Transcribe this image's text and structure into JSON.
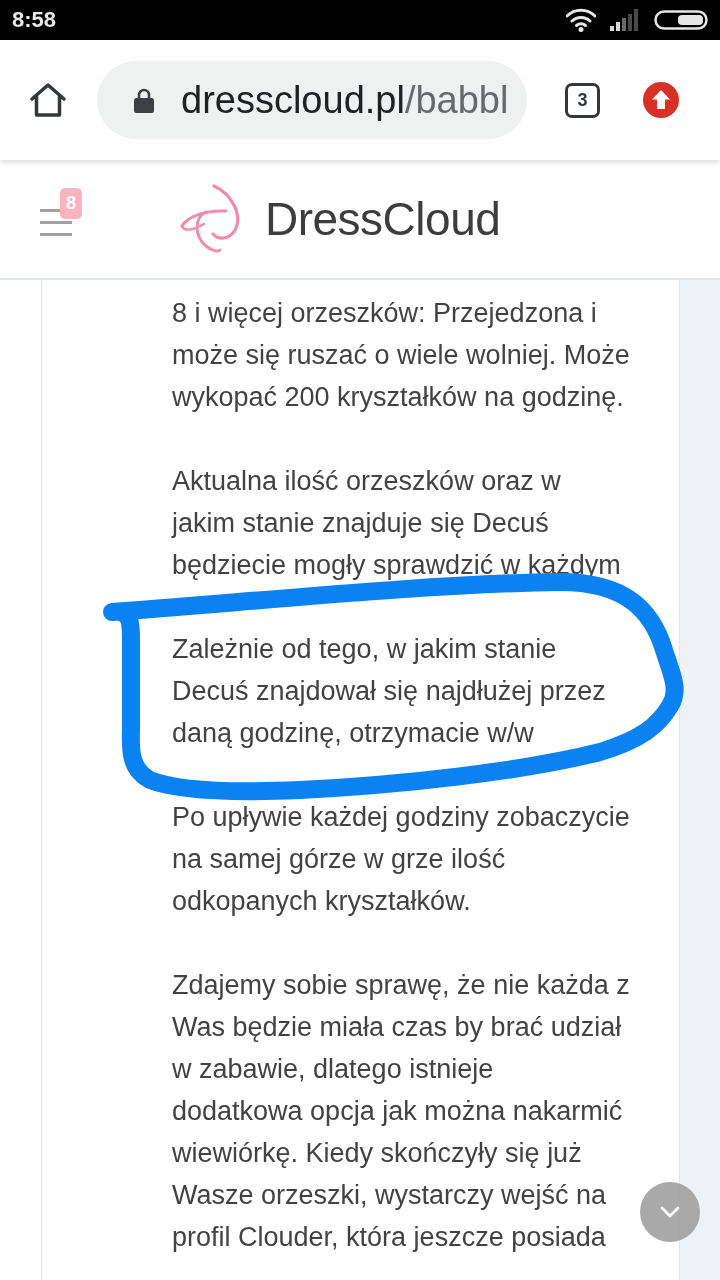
{
  "status_bar": {
    "time": "8:58"
  },
  "browser": {
    "url_domain": "dresscloud.pl",
    "url_path": "/babbl",
    "tab_count": "3"
  },
  "site_header": {
    "notification_count": "8",
    "brand": "DressCloud"
  },
  "article": {
    "paragraphs": [
      {
        "lines": [
          "8 i więcej orzeszków: Przejedzona i",
          "może się ruszać o wiele wolniej. Może",
          "wykopać 200 kryształków na godzinę."
        ]
      },
      {
        "lines": [
          "Aktualna ilość orzeszków oraz w",
          "jakim stanie znajduje się Decuś",
          "będziecie mogły sprawdzić w każdym"
        ]
      },
      {
        "lines": [
          "Zależnie od tego, w jakim stanie",
          "Decuś znajdował się najdłużej przez",
          "daną godzinę, otrzymacie w/w"
        ]
      },
      {
        "lines": [
          "Po upływie każdej godziny zobaczycie",
          "na samej górze w grze ilość",
          "odkopanych kryształków."
        ]
      },
      {
        "lines": [
          "Zdajemy sobie sprawę, że nie każda z",
          "Was będzie miała czas by brać udział",
          "w zabawie, dlatego istnieje",
          "dodatkowa opcja jak można nakarmić",
          "wiewiórkę. Kiedy skończyły się już",
          "Wasze orzeszki, wystarczy wejść na",
          "profil Clouder, która jeszcze posiada"
        ]
      }
    ]
  }
}
